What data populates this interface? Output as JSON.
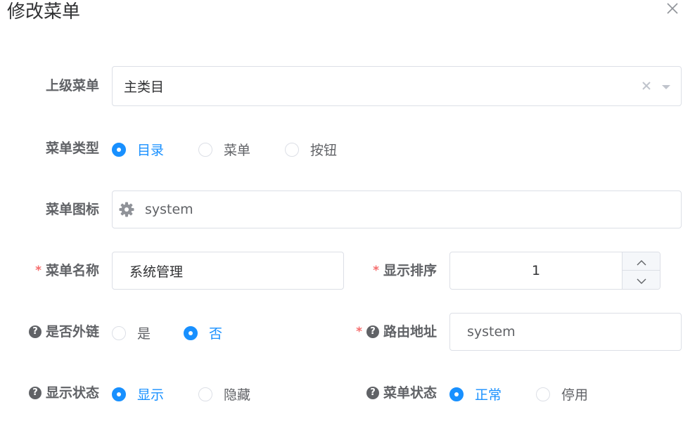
{
  "dialog": {
    "title": "修改菜单"
  },
  "form": {
    "parent_menu": {
      "label": "上级菜单",
      "value": "主类目"
    },
    "menu_type": {
      "label": "菜单类型",
      "options": [
        "目录",
        "菜单",
        "按钮"
      ],
      "selected": "目录"
    },
    "menu_icon": {
      "label": "菜单图标",
      "icon": "gear-icon",
      "value": "system"
    },
    "menu_name": {
      "label": "菜单名称",
      "required": "*",
      "value": "系统管理"
    },
    "display_order": {
      "label": "显示排序",
      "required": "*",
      "value": "1"
    },
    "is_external": {
      "label": "是否外链",
      "help": "?",
      "options": [
        "是",
        "否"
      ],
      "selected": "否"
    },
    "route_path": {
      "label": "路由地址",
      "required": "*",
      "help": "?",
      "value": "system"
    },
    "visible_status": {
      "label": "显示状态",
      "help": "?",
      "options": [
        "显示",
        "隐藏"
      ],
      "selected": "显示"
    },
    "menu_status": {
      "label": "菜单状态",
      "help": "?",
      "options": [
        "正常",
        "停用"
      ],
      "selected": "正常"
    }
  },
  "colors": {
    "primary": "#1890ff",
    "required": "#f56c6c",
    "border": "#dcdfe6",
    "label": "#606266"
  }
}
